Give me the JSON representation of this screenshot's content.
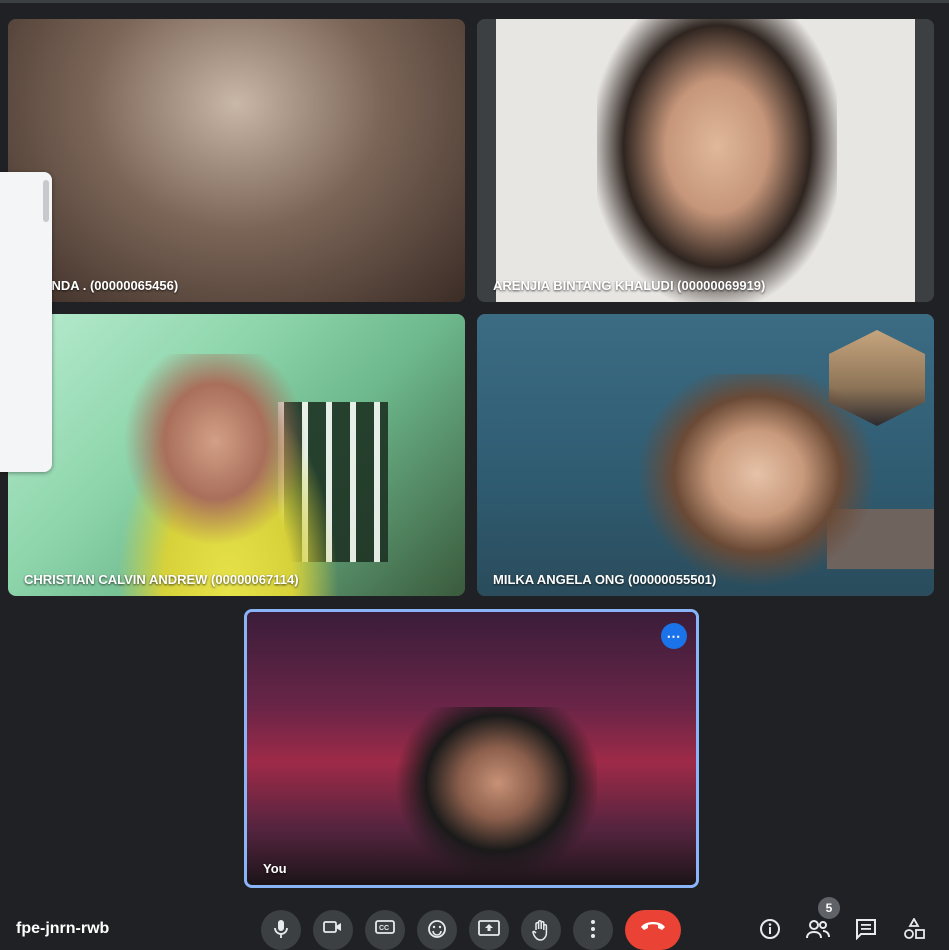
{
  "participants": [
    {
      "name": "BRENDA . (00000065456)"
    },
    {
      "name": "ARENJIA BINTANG KHALUDI (00000069919)"
    },
    {
      "name": "CHRISTIAN CALVIN ANDREW (00000067114)"
    },
    {
      "name": "MILKA ANGELA ONG (00000055501)"
    }
  ],
  "self_view": {
    "name": "You",
    "more_icon": "more-horiz-icon"
  },
  "meeting": {
    "code": "fpe-jnrn-rwb"
  },
  "controls": {
    "mic_icon": "microphone-icon",
    "camera_icon": "videocam-icon",
    "captions_icon": "closed-captions-icon",
    "reactions_icon": "emoji-icon",
    "present_icon": "present-screen-icon",
    "raise_hand_icon": "raise-hand-icon",
    "more_options_icon": "more-vert-icon",
    "end_call_icon": "call-end-icon"
  },
  "side_controls": {
    "info_icon": "info-icon",
    "people_icon": "people-icon",
    "people_count": "5",
    "chat_icon": "chat-icon",
    "activities_icon": "activities-icon"
  },
  "colors": {
    "background": "#202124",
    "end_call": "#ea4335",
    "active_speaker_border": "#8ab4f8",
    "more_button": "#1a73e8"
  }
}
